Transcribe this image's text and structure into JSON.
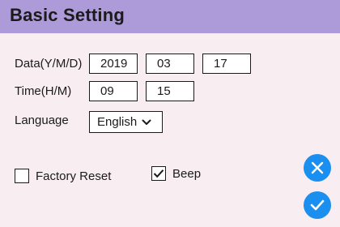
{
  "header": {
    "title": "Basic Setting"
  },
  "date": {
    "label": "Data(Y/M/D)",
    "year": "2019",
    "month": "03",
    "day": "17"
  },
  "time": {
    "label": "Time(H/M)",
    "hour": "09",
    "minute": "15"
  },
  "language": {
    "label": "Language",
    "selected": "English"
  },
  "options": {
    "factory_reset": {
      "label": "Factory Reset",
      "checked": false
    },
    "beep": {
      "label": "Beep",
      "checked": true
    }
  },
  "actions": {
    "cancel_icon": "close-icon",
    "confirm_icon": "check-icon",
    "accent_color": "#1a8ff0"
  }
}
